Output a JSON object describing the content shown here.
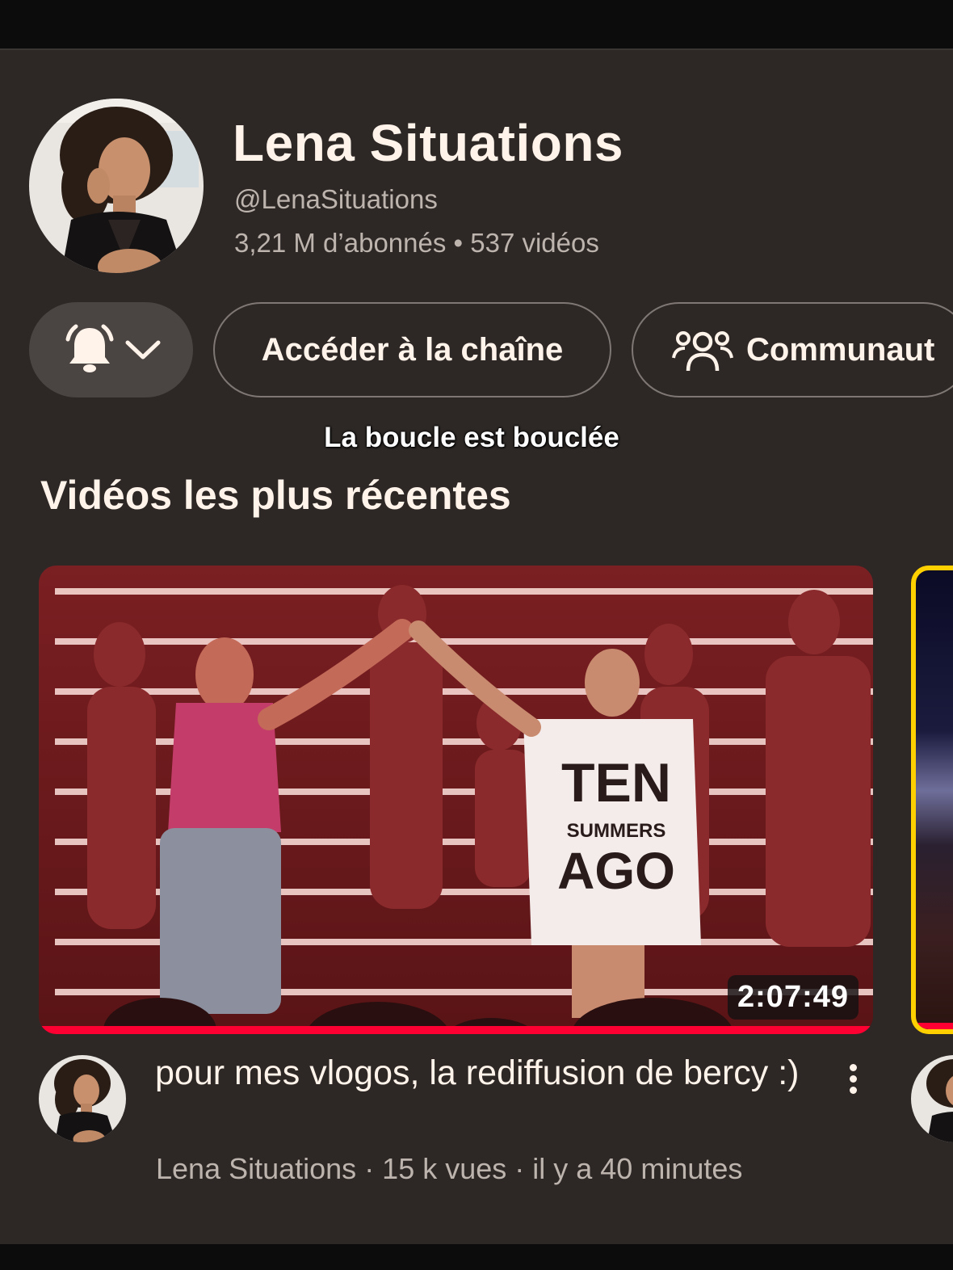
{
  "channel": {
    "name": "Lena Situations",
    "handle": "@LenaSituations",
    "stats": "3,21 M d’abonnés • 537 vidéos"
  },
  "actions": {
    "notifications_icon": "bell-icon",
    "dropdown_icon": "chevron-down-icon",
    "channel_button": "Accéder à la chaîne",
    "community_icon": "people-icon",
    "community_button": "Communaut"
  },
  "tagline": "La boucle est bouclée",
  "section": {
    "title": "Vidéos les plus récentes"
  },
  "video": {
    "duration": "2:07:49",
    "watched_fraction": 1.0,
    "title": "pour mes vlogos, la rediffusion de bercy :)",
    "meta": "Lena Situations · 15 k vues · il y a 40 minutes",
    "thumbnail_shirt_text": [
      "TEN",
      "SUMMERS",
      "AGO"
    ]
  },
  "colors": {
    "background": "#2d2826",
    "progress": "#ff0033",
    "next_thumb_border": "#ffd000"
  }
}
